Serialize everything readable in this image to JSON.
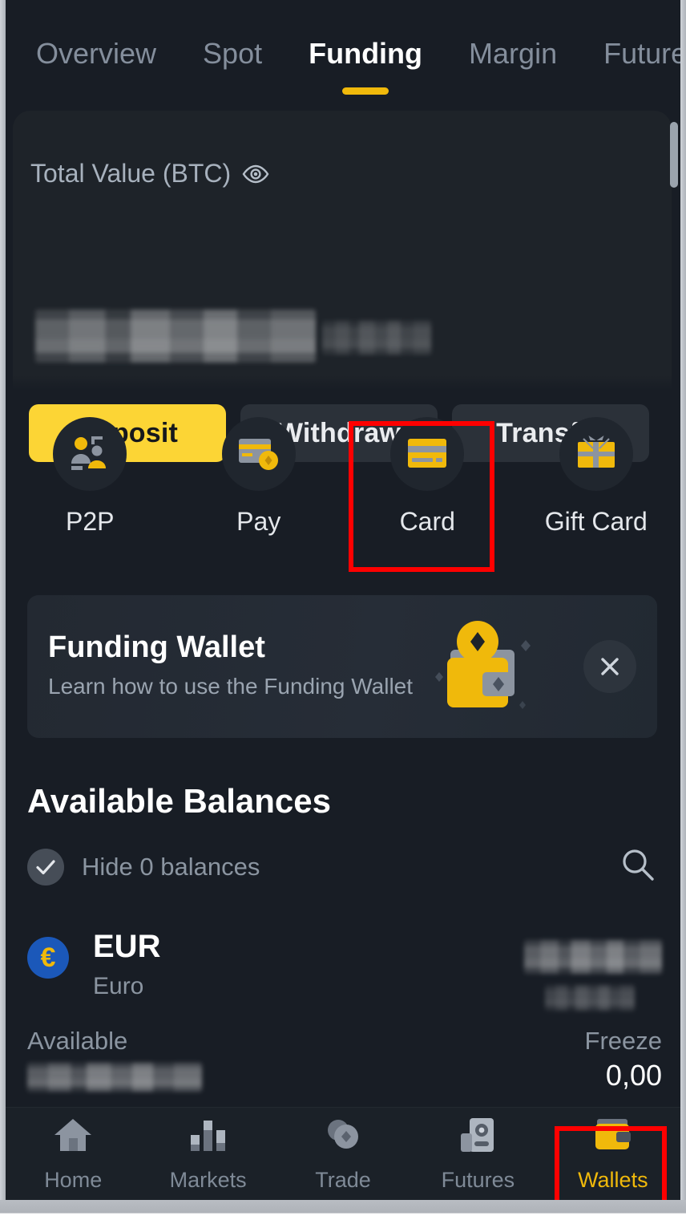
{
  "app": {
    "accent": "#f0b90b",
    "accent_button": "#fcd535",
    "background": "#181d25",
    "card_background": "#1e2329",
    "annotation_color": "#ff0000"
  },
  "tabs": [
    {
      "label": "Overview",
      "active": false
    },
    {
      "label": "Spot",
      "active": false
    },
    {
      "label": "Funding",
      "active": true
    },
    {
      "label": "Margin",
      "active": false
    },
    {
      "label": "Future",
      "active": false
    }
  ],
  "header": {
    "total_value_label": "Total Value (BTC)",
    "eye_icon": "eye-icon",
    "balance_value": "",
    "balance_secondary": "",
    "buttons": [
      {
        "label": "Deposit",
        "style": "primary"
      },
      {
        "label": "Withdraw",
        "style": "ghost"
      },
      {
        "label": "Transfer",
        "style": "ghost"
      }
    ]
  },
  "quick_actions": [
    {
      "label": "P2P",
      "icon": "p2p-people-icon",
      "highlighted": false
    },
    {
      "label": "Pay",
      "icon": "pay-card-coin-icon",
      "highlighted": false
    },
    {
      "label": "Card",
      "icon": "credit-card-icon",
      "highlighted": true
    },
    {
      "label": "Gift Card",
      "icon": "gift-box-icon",
      "highlighted": false
    }
  ],
  "banner": {
    "title": "Funding Wallet",
    "subtitle": "Learn how to use the Funding Wallet",
    "art_icon": "wallet-lock-icon",
    "close_icon": "close-icon"
  },
  "balances": {
    "section_title": "Available Balances",
    "hide_label": "Hide 0 balances",
    "hide_checked": true,
    "check_icon": "check-circle-icon",
    "search_icon": "search-icon",
    "rows": [
      {
        "symbol": "EUR",
        "name": "Euro",
        "coin_icon": "euro-icon",
        "coin_glyph": "€",
        "total_value": "",
        "total_value_secondary": "",
        "available_label": "Available",
        "available_value": "",
        "freeze_label": "Freeze",
        "freeze_value": "0,00"
      }
    ]
  },
  "bottom_nav": [
    {
      "label": "Home",
      "icon": "home-icon",
      "active": false
    },
    {
      "label": "Markets",
      "icon": "bar-chart-icon",
      "active": false
    },
    {
      "label": "Trade",
      "icon": "trade-diamond-icon",
      "active": false
    },
    {
      "label": "Futures",
      "icon": "futures-icon",
      "active": false
    },
    {
      "label": "Wallets",
      "icon": "wallet-icon",
      "active": true
    }
  ]
}
